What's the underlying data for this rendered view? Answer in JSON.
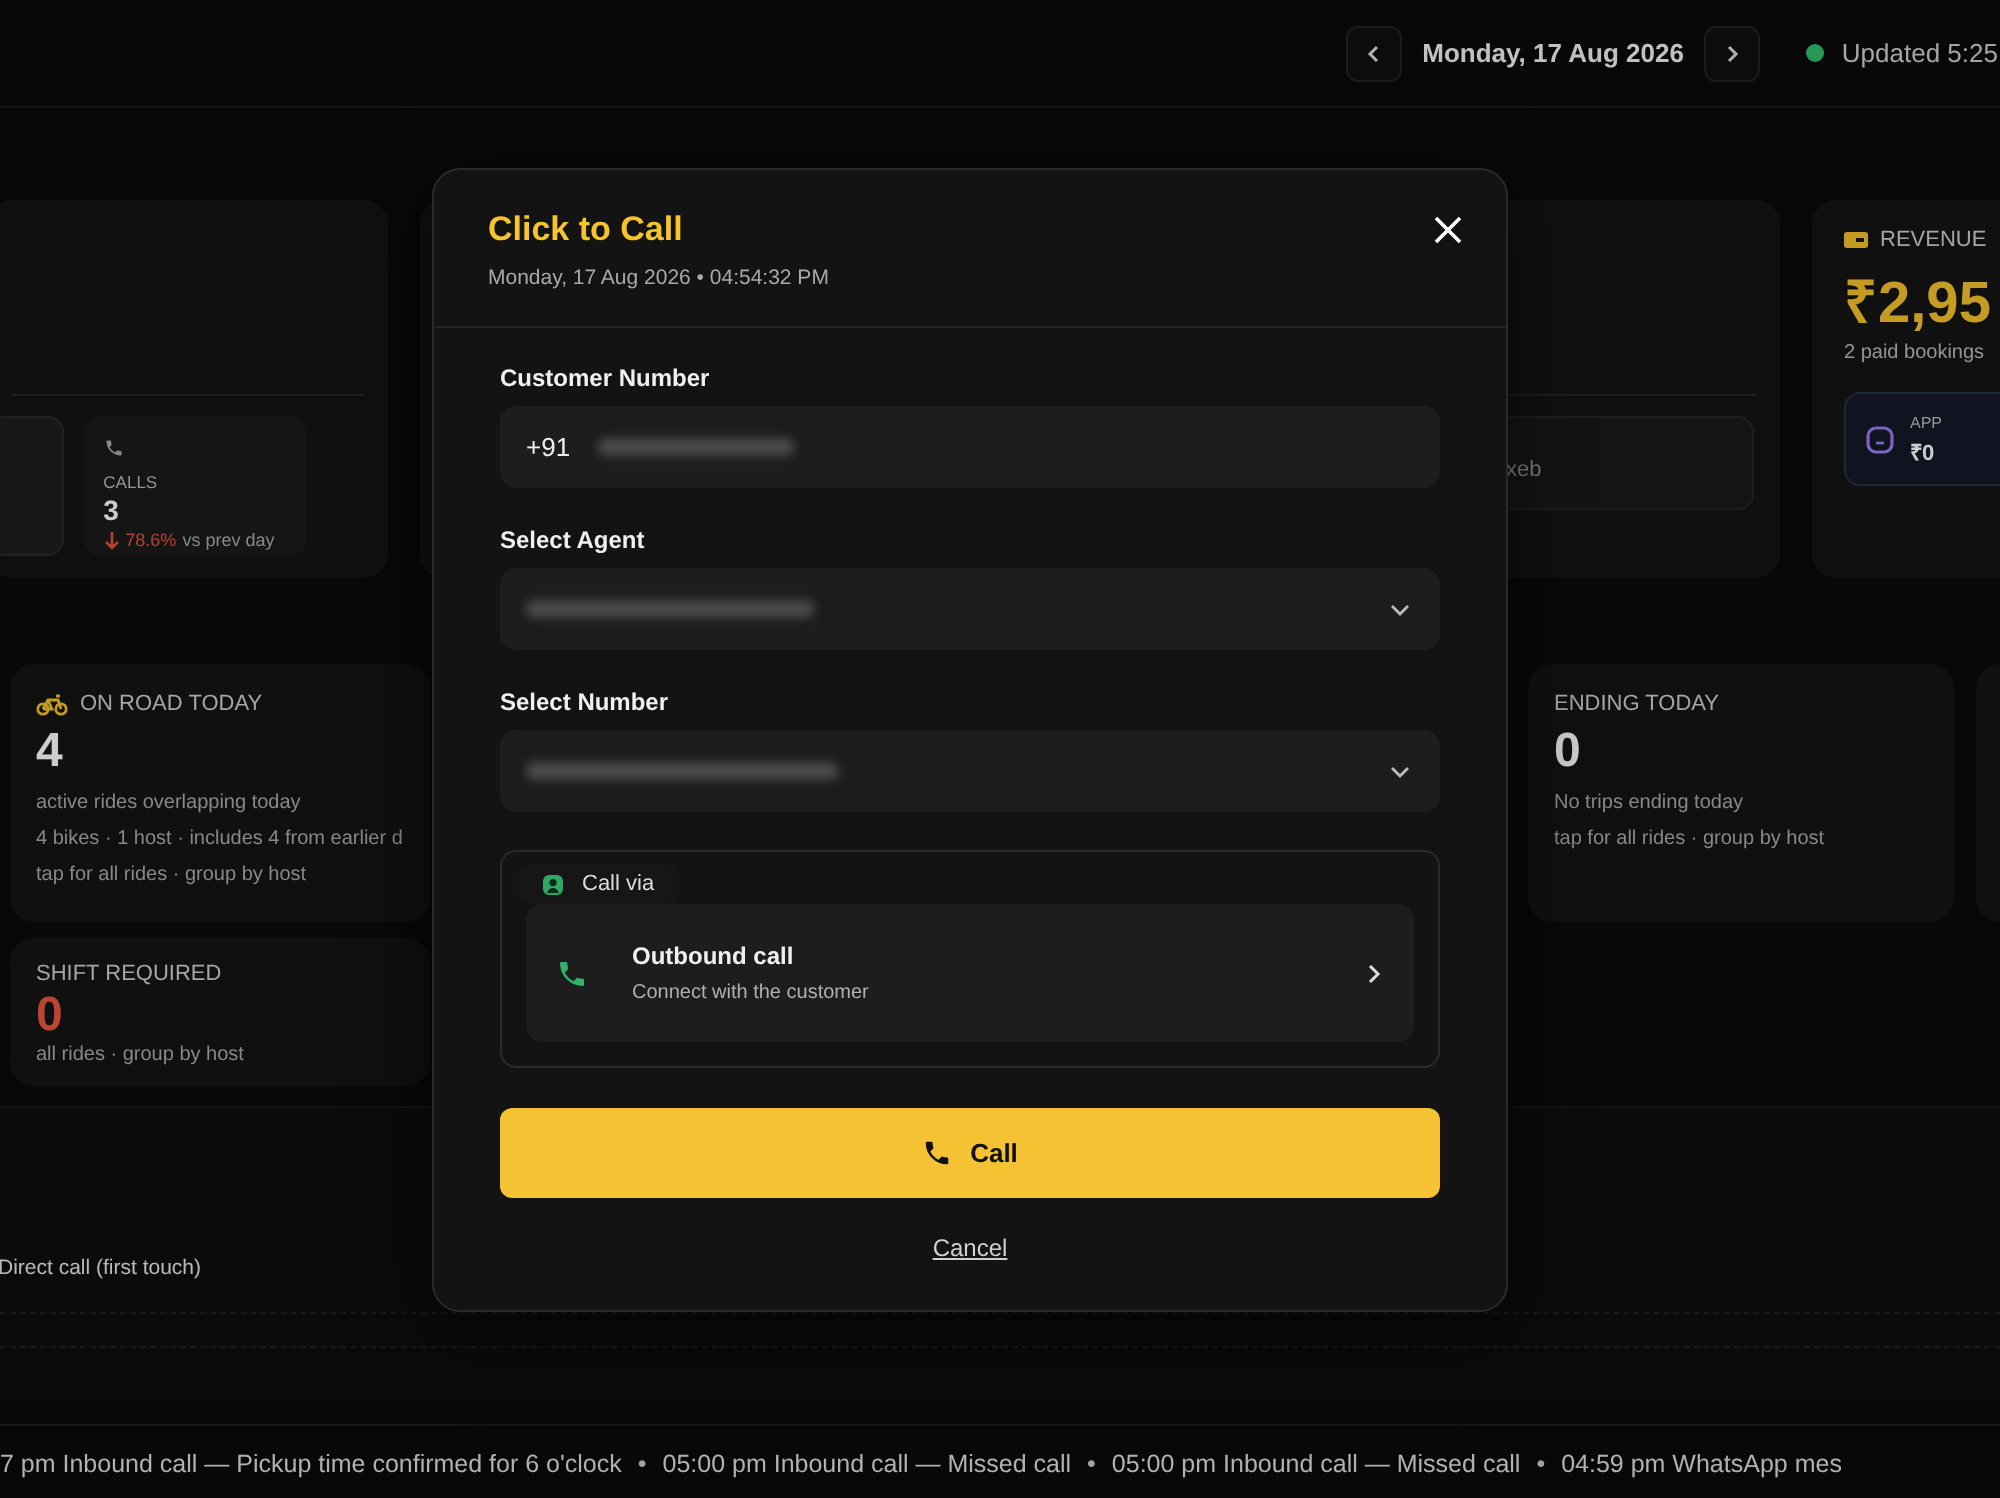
{
  "header": {
    "date": "Monday, 17 Aug 2026",
    "status": "Updated 5:25",
    "online": true
  },
  "calls": {
    "label": "CALLS",
    "value": "3",
    "change": "78.6%",
    "change_label": "vs prev day"
  },
  "partial_text": "xeb",
  "revenue": {
    "label": "REVENUE",
    "value": "₹2,95",
    "note": "2 paid bookings",
    "sources": [
      {
        "label": "APP",
        "value": "₹0"
      }
    ]
  },
  "on_road": {
    "label": "ON ROAD TODAY",
    "value": "4",
    "lines": [
      "active rides overlapping today",
      "4 bikes · 1 host · includes 4 from earlier d",
      "tap for all rides · group by host"
    ]
  },
  "shift_required": {
    "label": "SHIFT REQUIRED",
    "value": "0",
    "alert": true,
    "note": "all rides · group by host"
  },
  "ending_today": {
    "label": "ENDING TODAY",
    "value": "0",
    "lines": [
      "No trips ending today",
      "tap for all rides · group by host"
    ]
  },
  "bottom_note": "Direct call (first touch)",
  "ticker": {
    "separator": "•",
    "items": [
      "7 pm Inbound call — Pickup time confirmed for 6 o'clock",
      "05:00 pm Inbound call — Missed call",
      "05:00 pm Inbound call — Missed call",
      "04:59 pm WhatsApp mes"
    ]
  },
  "modal": {
    "title": "Click to Call",
    "subtitle": "Monday, 17 Aug 2026 • 04:54:32 PM",
    "fields": [
      {
        "label": "Customer Number",
        "kind": "phone",
        "prefix": "+91"
      },
      {
        "label": "Select Agent",
        "kind": "select"
      },
      {
        "label": "Select Number",
        "kind": "select"
      }
    ],
    "call_via": {
      "label": "Call via",
      "options": [
        {
          "title": "Outbound call",
          "subtitle": "Connect with the customer"
        }
      ]
    },
    "primary": "Call",
    "cancel": "Cancel"
  }
}
